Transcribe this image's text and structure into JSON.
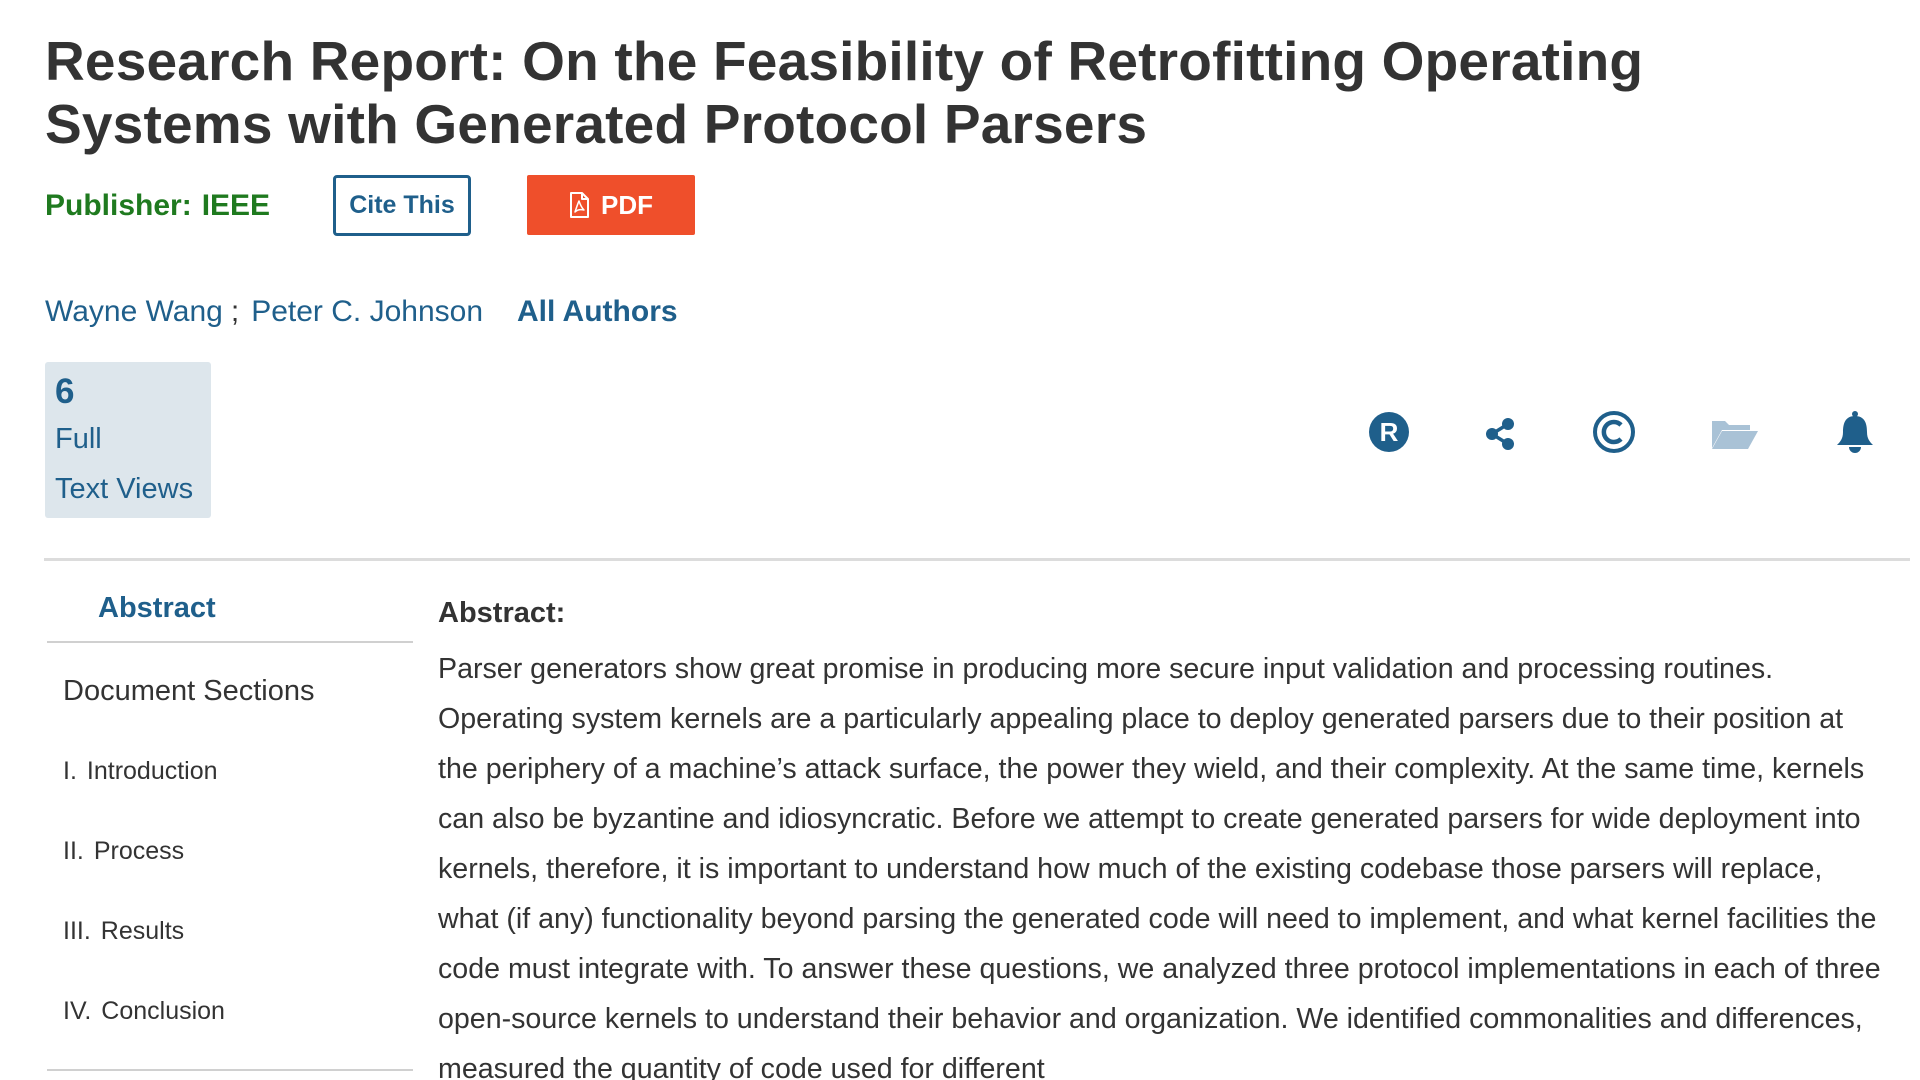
{
  "document": {
    "title": "Research Report: On the Feasibility of Retrofitting Operating Systems with Generated Protocol Parsers"
  },
  "publisher": {
    "label": "Publisher:",
    "value": "IEEE"
  },
  "actions": {
    "cite_label": "Cite This",
    "pdf_label": "PDF"
  },
  "authors": {
    "names": [
      "Wayne Wang",
      "Peter C. Johnson"
    ],
    "separator": ";",
    "all_authors_label": "All Authors"
  },
  "metrics": {
    "count": "6",
    "label_line1": "Full",
    "label_line2": "Text Views"
  },
  "toolbar_icons": [
    "rights-r-icon",
    "share-icon",
    "copyright-icon",
    "folder-icon",
    "bell-icon"
  ],
  "nav": {
    "abstract_label": "Abstract",
    "sections_heading": "Document Sections",
    "items": [
      {
        "num": "I.",
        "label": "Introduction"
      },
      {
        "num": "II.",
        "label": "Process"
      },
      {
        "num": "III.",
        "label": "Results"
      },
      {
        "num": "IV.",
        "label": "Conclusion"
      }
    ]
  },
  "abstract": {
    "heading": "Abstract:",
    "text": "Parser generators show great promise in producing more secure input validation and processing routines. Operating system kernels are a particularly appealing place to deploy generated parsers due to their position at the periphery of a machine’s attack surface, the power they wield, and their complexity. At the same time, kernels can also be byzantine and idiosyncratic. Before we attempt to create generated parsers for wide deployment into kernels, therefore, it is important to understand how much of the existing codebase those parsers will replace, what (if any) functionality beyond parsing the generated code will need to implement, and what kernel facilities the code must integrate with. To answer these questions, we analyzed three protocol implementations in each of three open-source kernels to understand their behavior and organization. We identified commonalities and differences, measured the quantity of code used for different"
  },
  "colors": {
    "link_blue": "#1f5f8b",
    "publisher_green": "#1f7a1f",
    "pdf_orange": "#ef4f2b",
    "metrics_bg": "#dde6ec",
    "folder_light_blue": "#a9c2d6"
  }
}
